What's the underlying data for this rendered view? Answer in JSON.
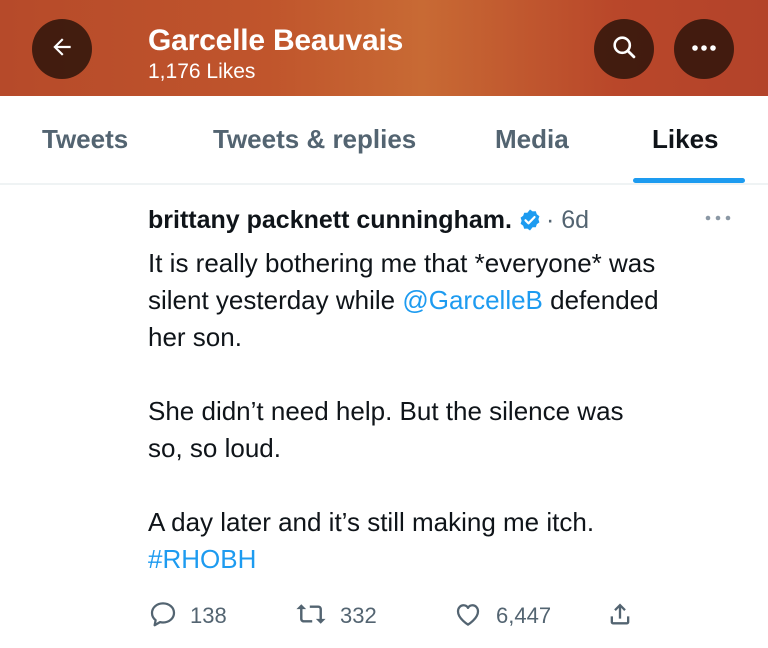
{
  "header": {
    "profile_name": "Garcelle Beauvais",
    "likes_count": "1,176 Likes",
    "back_icon": "arrow-left-icon",
    "search_icon": "search-icon",
    "more_icon": "more-horizontal-icon",
    "gradient_color": "#c0552c"
  },
  "tabs": [
    {
      "label": "Tweets",
      "active": false
    },
    {
      "label": "Tweets & replies",
      "active": false
    },
    {
      "label": "Media",
      "active": false
    },
    {
      "label": "Likes",
      "active": true
    }
  ],
  "accent_color": "#1d9bf0",
  "tweet": {
    "author_name": "brittany packnett cunningham.",
    "verified_icon": "verified-badge-icon",
    "time": "· 6d",
    "more_icon": "more-horizontal-icon",
    "lines": {
      "l1": "It is really bothering me that *everyone* was",
      "l2_pre": "silent yesterday while ",
      "l2_mention": "@GarcelleB",
      "l2_post": " defended",
      "l3": "her son.",
      "l4": "She didn’t need help. But the silence was",
      "l5": "so, so loud.",
      "l6": "A day later and it’s still making me itch.",
      "l7_hashtag": "#RHOBH"
    },
    "actions": {
      "reply_count": "138",
      "retweet_count": "332",
      "like_count": "6,447"
    }
  }
}
